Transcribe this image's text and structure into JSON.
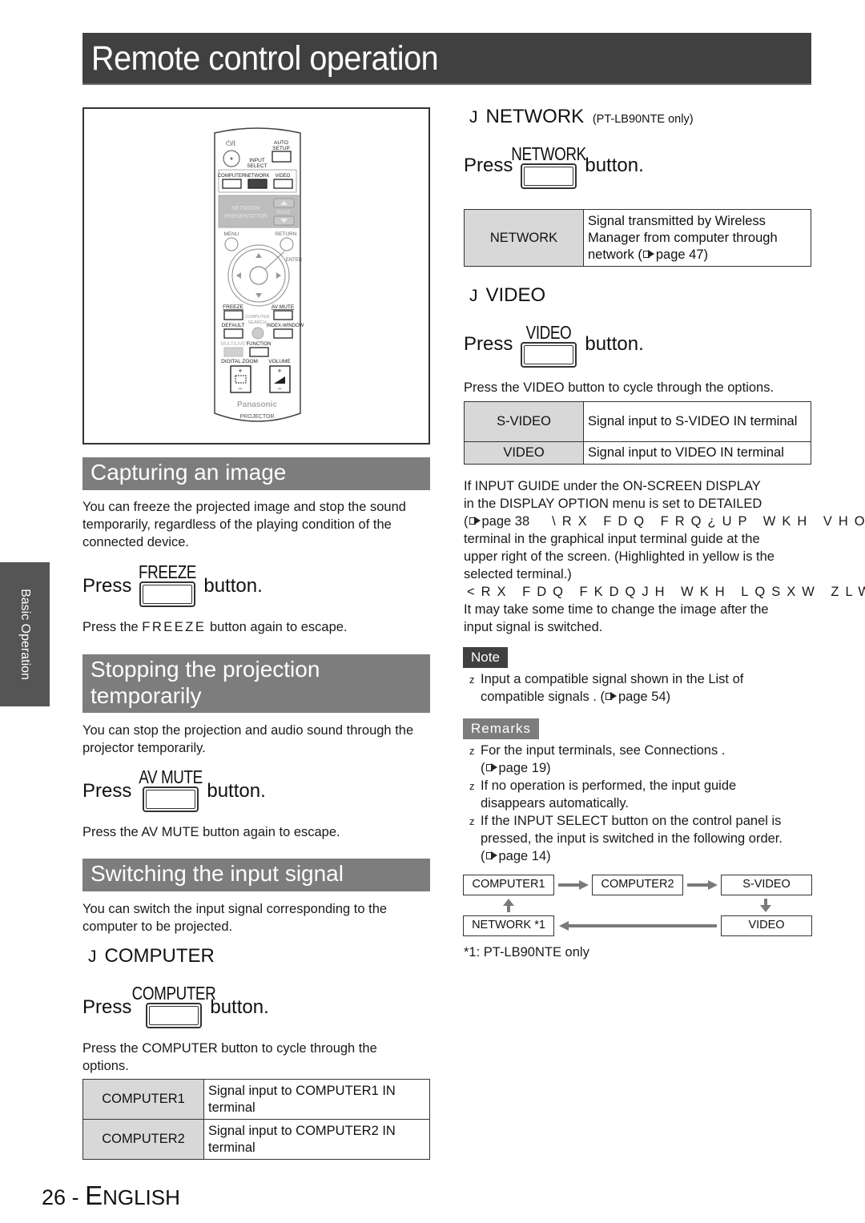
{
  "page": {
    "title": "Remote control operation",
    "side_tab": "Basic Operation",
    "footer_page": "26",
    "footer_dash": "-",
    "footer_lang_first": "E",
    "footer_lang_rest": "NGLISH"
  },
  "remote": {
    "brand": "Panasonic",
    "model_label": "PROJECTOR",
    "buttons": {
      "power": "⏻/I",
      "auto_setup": "AUTO SETUP",
      "input_select": "INPUT SELECT",
      "computer": "COMPUTER",
      "network": "NETWORK",
      "video": "VIDEO",
      "network_presentation": "NETWORK PRESENTATION",
      "page": "PAGE",
      "menu": "MENU",
      "return": "RETURN",
      "enter": "ENTER",
      "freeze": "FREEZE",
      "av_mute": "AV MUTE",
      "computer_search": "COMPUTER SEARCH",
      "default": "DEFAULT",
      "index_window": "INDEX-WINDOW",
      "multi_live": "MULTILIVE",
      "function": "FUNCTION",
      "digital_zoom": "DIGITAL ZOOM",
      "volume": "VOLUME",
      "plus": "+",
      "minus": "−"
    },
    "highlighted_button": "network"
  },
  "capture": {
    "heading": "Capturing an image",
    "intro": "You can freeze the projected image and stop the sound temporarily, regardless of the playing condition of the connected device.",
    "press": "Press",
    "button_name": "FREEZE",
    "button_suffix": "button.",
    "escape_pre": "Press the ",
    "escape_key": "FREEZE",
    "escape_post": " button again to escape."
  },
  "stop": {
    "heading": "Stopping the projection temporarily",
    "intro": "You can stop the projection and audio sound through the projector temporarily.",
    "press": "Press",
    "button_name": "AV MUTE",
    "button_suffix": "button.",
    "escape": "Press the AV MUTE button again to escape."
  },
  "switch": {
    "heading": "Switching the input signal",
    "intro": "You can switch the input signal corresponding to the computer to be projected.",
    "computer": {
      "bullet": "J",
      "title": "COMPUTER",
      "press": "Press",
      "button_name": "COMPUTER",
      "button_suffix": "button.",
      "cycle_text": "Press the COMPUTER button to cycle through the options.",
      "rows": [
        {
          "key": "COMPUTER1",
          "value": "Signal input to COMPUTER1 IN terminal"
        },
        {
          "key": "COMPUTER2",
          "value": "Signal input to COMPUTER2 IN terminal"
        }
      ]
    },
    "network": {
      "bullet": "J",
      "title": "NETWORK",
      "note": "(PT-LB90NTE only)",
      "press": "Press",
      "button_name": "NETWORK",
      "button_suffix": "button.",
      "rows": [
        {
          "key": "NETWORK",
          "value_l1": "Signal transmitted by  Wireless",
          "value_l2": "Manager  from computer through",
          "value_l3_pre": "network (",
          "value_l3_post": "page 47)"
        }
      ]
    },
    "video": {
      "bullet": "J",
      "title": "VIDEO",
      "press": "Press",
      "button_name": "VIDEO",
      "button_suffix": "button.",
      "cycle_text": "Press the VIDEO button to cycle through the options.",
      "rows": [
        {
          "key": "S-VIDEO",
          "value": "Signal input to S-VIDEO IN terminal"
        },
        {
          "key": "VIDEO",
          "value": "Signal input to VIDEO IN terminal"
        }
      ]
    },
    "guide_lines": [
      "If INPUT GUIDE under the ON-SCREEN DISPLAY",
      "in the DISPLAY OPTION  menu is set to DETAILED",
      "terminal in the graphical input terminal guide at the",
      "upper right of the screen. (Highlighted in yellow is the",
      "selected terminal.)",
      "It may take some time to change the image after the",
      "input signal is switched."
    ],
    "guide_ref_pre": "(",
    "guide_ref_page": "page 38",
    "guide_garbled_1": "\\RX FDQ FRQ¿UP WKH VHOHF",
    "guide_garbled_2": "<RX FDQ FKDQJH WKH LQSXW ZLWK x"
  },
  "note": {
    "label": "Note",
    "bullet_glyph": "z",
    "items": [
      {
        "l1": "Input a compatible signal shown in the  List of",
        "l2_pre": "compatible signals . (",
        "l2_post": "page 54)"
      }
    ]
  },
  "remarks": {
    "label": "Remarks",
    "bullet_glyph": "z",
    "items": [
      {
        "l1": "For the input terminals, see  Connections .",
        "l2_pre": "(",
        "l2_post": "page 19)"
      },
      {
        "l1": "If no operation is performed, the input guide",
        "l2": "disappears automatically."
      },
      {
        "l1": "If the INPUT SELECT button on the control panel is",
        "l2": "pressed, the input is switched in the following order.",
        "l3_pre": "(",
        "l3_post": "page 14)"
      }
    ]
  },
  "flow": {
    "nodes": [
      "COMPUTER1",
      "COMPUTER2",
      "S-VIDEO",
      "VIDEO",
      "NETWORK *1"
    ],
    "footnote": "*1:  PT-LB90NTE only",
    "arrow_color": "#7a7a7a"
  },
  "colors": {
    "title_bar": "#404040",
    "section_header": "#7d7d7d",
    "side_tab": "#555555",
    "table_key_bg": "#d8d8d8",
    "note_chip": "#404040",
    "remarks_chip": "#7d7d7d"
  }
}
